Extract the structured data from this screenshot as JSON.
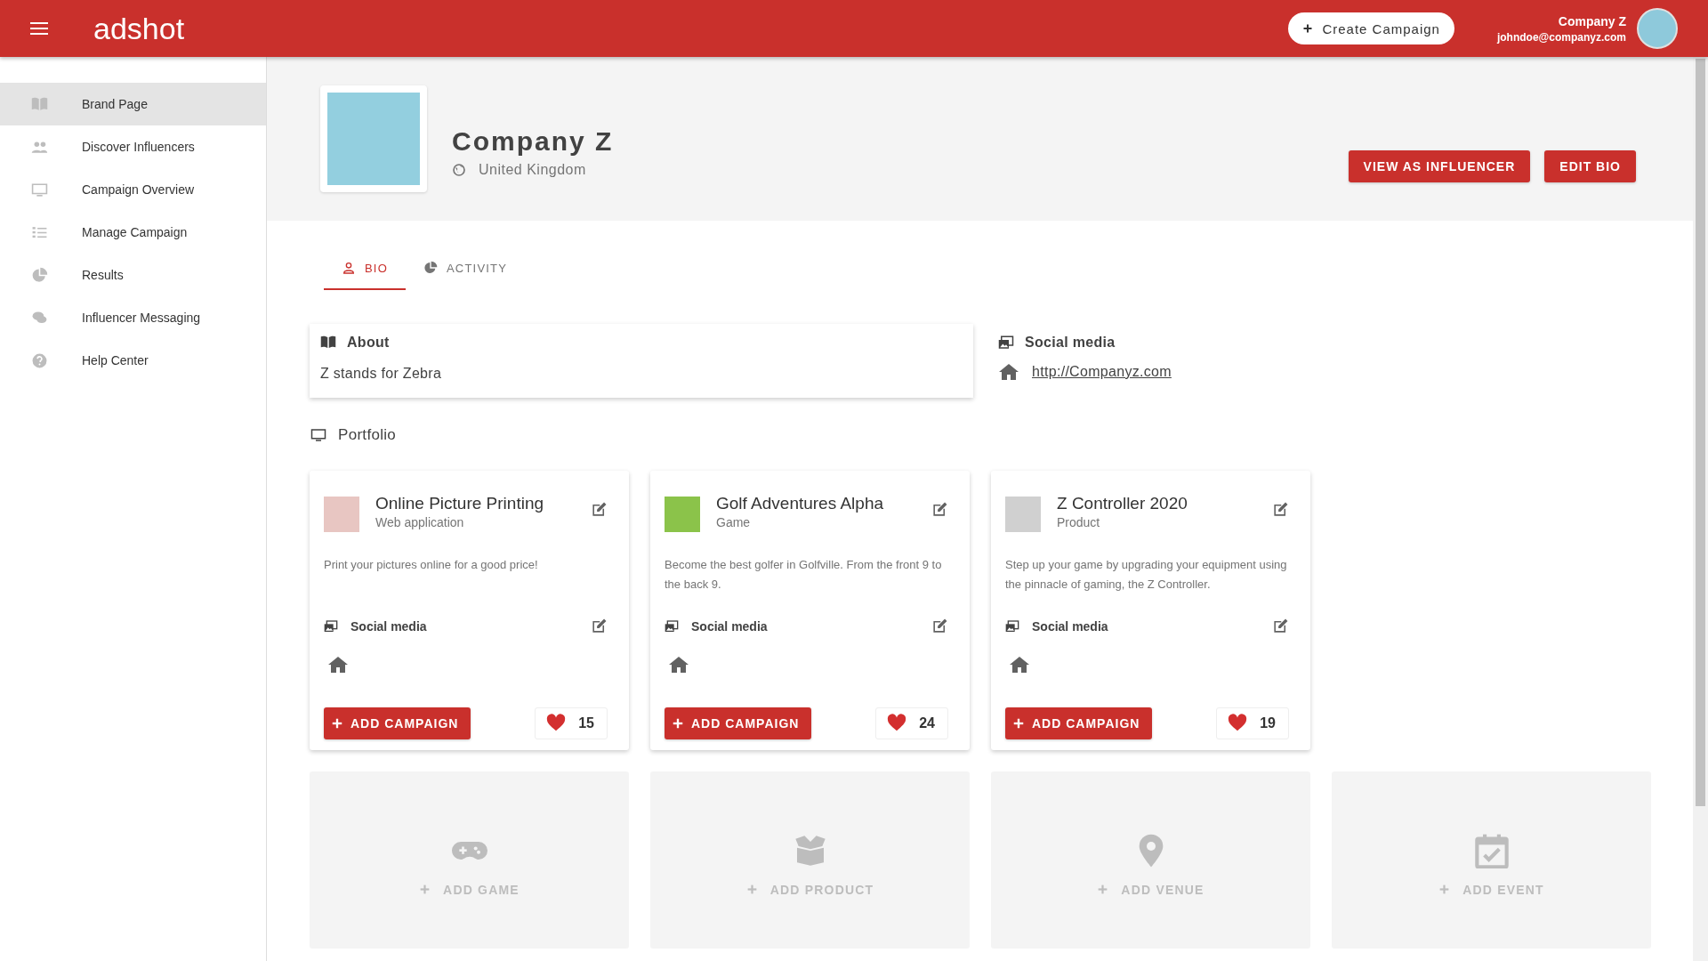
{
  "header": {
    "logo": "adshot",
    "create_button": "Create Campaign",
    "user": {
      "name": "Company Z",
      "email": "johndoe@companyz.com"
    }
  },
  "sidebar": {
    "items": [
      {
        "label": "Brand Page",
        "kind": "book",
        "selected": true
      },
      {
        "label": "Discover Influencers",
        "kind": "people",
        "selected": false
      },
      {
        "label": "Campaign Overview",
        "kind": "monitor",
        "selected": false
      },
      {
        "label": "Manage Campaign",
        "kind": "checklist",
        "selected": false
      },
      {
        "label": "Results",
        "kind": "pie",
        "selected": false
      },
      {
        "label": "Influencer Messaging",
        "kind": "chat",
        "selected": false
      },
      {
        "label": "Help Center",
        "kind": "help",
        "selected": false
      }
    ]
  },
  "profile": {
    "name": "Company Z",
    "country": "United Kingdom",
    "buttons": [
      "VIEW AS INFLUENCER",
      "EDIT BIO"
    ]
  },
  "tabs": [
    {
      "label": "BIO",
      "kind": "person",
      "selected": true
    },
    {
      "label": "ACTIVITY",
      "kind": "pie",
      "selected": false
    }
  ],
  "about": {
    "title": "About",
    "text": "Z stands for Zebra"
  },
  "social": {
    "title": "Social media",
    "link": "http://Companyz.com"
  },
  "portfolio": {
    "title": "Portfolio",
    "items": [
      {
        "title": "Online Picture Printing",
        "type": "Web application",
        "description": "Print your pictures online for a good price!",
        "social_title": "Social media",
        "button": "ADD CAMPAIGN",
        "likes": "15"
      },
      {
        "title": "Golf Adventures Alpha",
        "type": "Game",
        "description": "Become the best golfer in Golfville. From the front 9 to the back 9.",
        "social_title": "Social media",
        "button": "ADD CAMPAIGN",
        "likes": "24"
      },
      {
        "title": "Z Controller 2020",
        "type": "Product",
        "description": "Step up your game by upgrading your equipment using the pinnacle of gaming, the Z Controller.",
        "social_title": "Social media",
        "button": "ADD CAMPAIGN",
        "likes": "19"
      }
    ],
    "add_tiles": [
      {
        "kind": "game",
        "label": "ADD GAME"
      },
      {
        "kind": "product",
        "label": "ADD PRODUCT"
      },
      {
        "kind": "venue",
        "label": "ADD VENUE"
      },
      {
        "kind": "event",
        "label": "ADD EVENT"
      }
    ]
  }
}
